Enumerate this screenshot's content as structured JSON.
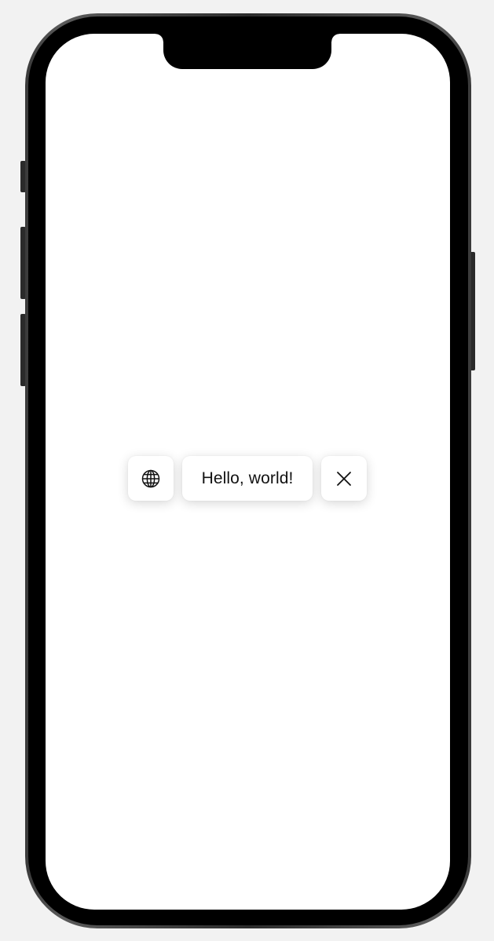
{
  "overlay": {
    "globe_icon": "globe-icon",
    "message": "Hello, world!",
    "close_icon": "close-icon"
  },
  "colors": {
    "screen_background": "#ffffff",
    "device_bezel": "#000000",
    "page_background": "#f2f2f2",
    "chip_background": "#ffffff",
    "text": "#111111"
  }
}
